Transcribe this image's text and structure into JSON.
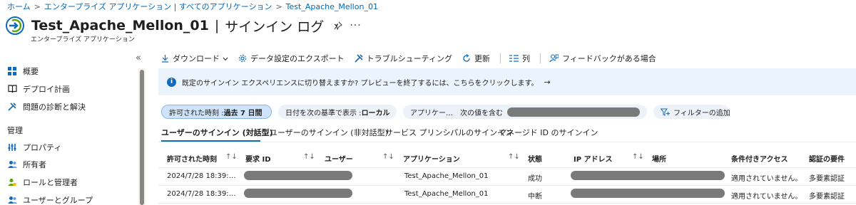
{
  "breadcrumb": [
    "ホーム",
    "エンタープライズ アプリケーション | すべてのアプリケーション",
    "Test_Apache_Mellon_01"
  ],
  "header": {
    "app_name": "Test_Apache_Mellon_01",
    "separator": "|",
    "page": "サインイン ログ",
    "subtitle": "エンタープライズ アプリケーション",
    "more": "···"
  },
  "sidebar": {
    "collapse": "«",
    "items": [
      {
        "label": "概要",
        "icon": "grid-icon"
      },
      {
        "label": "デプロイ計画",
        "icon": "book-icon"
      },
      {
        "label": "問題の診断と解決",
        "icon": "wrench-icon"
      }
    ],
    "heading": "管理",
    "manage_items": [
      {
        "label": "プロパティ",
        "icon": "properties-icon"
      },
      {
        "label": "所有者",
        "icon": "users-icon"
      },
      {
        "label": "ロールと管理者",
        "icon": "role-icon"
      },
      {
        "label": "ユーザーとグループ",
        "icon": "users-icon"
      }
    ]
  },
  "toolbar": {
    "download": "ダウンロード",
    "export": "データ設定のエクスポート",
    "troubleshoot": "トラブルシューティング",
    "refresh": "更新",
    "columns": "列",
    "feedback": "フィードバックがある場合"
  },
  "banner": {
    "text": "既定のサインイン エクスペリエンスに切り替えますか? プレビューを終了するには、こちらをクリックします。",
    "arrow": "→"
  },
  "filters": {
    "time_prefix": "許可された時刻 : ",
    "time_value": "過去 7 日間",
    "date_prefix": "日付を次の基準で表示 : ",
    "date_value": "ローカル",
    "app_filter": "アプリケー…　次の値を含む",
    "add_filter": "フィルターの追加"
  },
  "tabs": [
    "ユーザーのサインイン (対話型)",
    "ユーザーのサインイン (非対話型)",
    "サービス プリンシパルのサインイン",
    "マネージド ID のサインイン"
  ],
  "table": {
    "headers": [
      "許可された時刻",
      "要求 ID",
      "ユーザー",
      "アプリケーション",
      "状態",
      "IP アドレス",
      "場所",
      "条件付きアクセス",
      "認証の要件"
    ],
    "rows": [
      {
        "time": "2024/7/28 18:39:…",
        "app": "Test_Apache_Mellon_01",
        "status": "成功",
        "ca": "適用されていません。",
        "auth": "多要素認証"
      },
      {
        "time": "2024/7/28 18:39:…",
        "app": "Test_Apache_Mellon_01",
        "status": "中断",
        "ca": "適用されていません。",
        "auth": "多要素認証"
      }
    ]
  },
  "colors": {
    "accent": "#0f6cbd",
    "link": "#0067b8",
    "banner_bg": "#ebf3fc",
    "redaction": "#7a7a7a"
  }
}
